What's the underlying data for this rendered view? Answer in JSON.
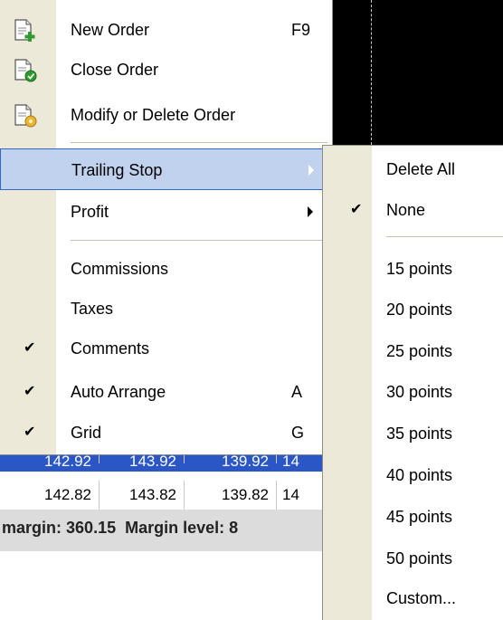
{
  "menu": {
    "items": [
      {
        "label": "New Order",
        "shortcut": "F9",
        "icon": "new-order-icon"
      },
      {
        "label": "Close Order",
        "icon": "close-order-icon"
      },
      {
        "label": "Modify or Delete Order",
        "icon": "modify-order-icon"
      },
      {
        "label": "Trailing Stop",
        "submenu": true,
        "highlighted": true
      },
      {
        "label": "Profit",
        "submenu": true
      },
      {
        "label": "Commissions"
      },
      {
        "label": "Taxes"
      },
      {
        "label": "Comments",
        "checked": true,
        "check_glyph": "✔"
      },
      {
        "label": "Auto Arrange",
        "shortcut": "A",
        "checked": true,
        "check_glyph": "✔"
      },
      {
        "label": "Grid",
        "shortcut": "G",
        "checked": true,
        "check_glyph": "✔"
      }
    ]
  },
  "submenu": {
    "items": [
      {
        "label": "Delete All"
      },
      {
        "label": "None",
        "checked": true,
        "check_glyph": "✔"
      },
      {
        "label": "15 points"
      },
      {
        "label": "20 points"
      },
      {
        "label": "25 points"
      },
      {
        "label": "30 points"
      },
      {
        "label": "35 points"
      },
      {
        "label": "40 points"
      },
      {
        "label": "45 points"
      },
      {
        "label": "50 points"
      },
      {
        "label": "Custom..."
      }
    ]
  },
  "background": {
    "selected_row": [
      "142.92",
      "143.92",
      "139.92",
      "14"
    ],
    "row": [
      "142.82",
      "143.82",
      "139.82",
      "14"
    ],
    "status": {
      "margin_label": "margin:",
      "margin_value": "360.15",
      "margin_level_label": "Margin level:",
      "margin_level_value": "8"
    }
  },
  "colors": {
    "highlight_bg": "#c1d2ee",
    "highlight_border": "#316ac5",
    "gutter": "#ece9d8",
    "selected_row": "#2a56c6"
  }
}
